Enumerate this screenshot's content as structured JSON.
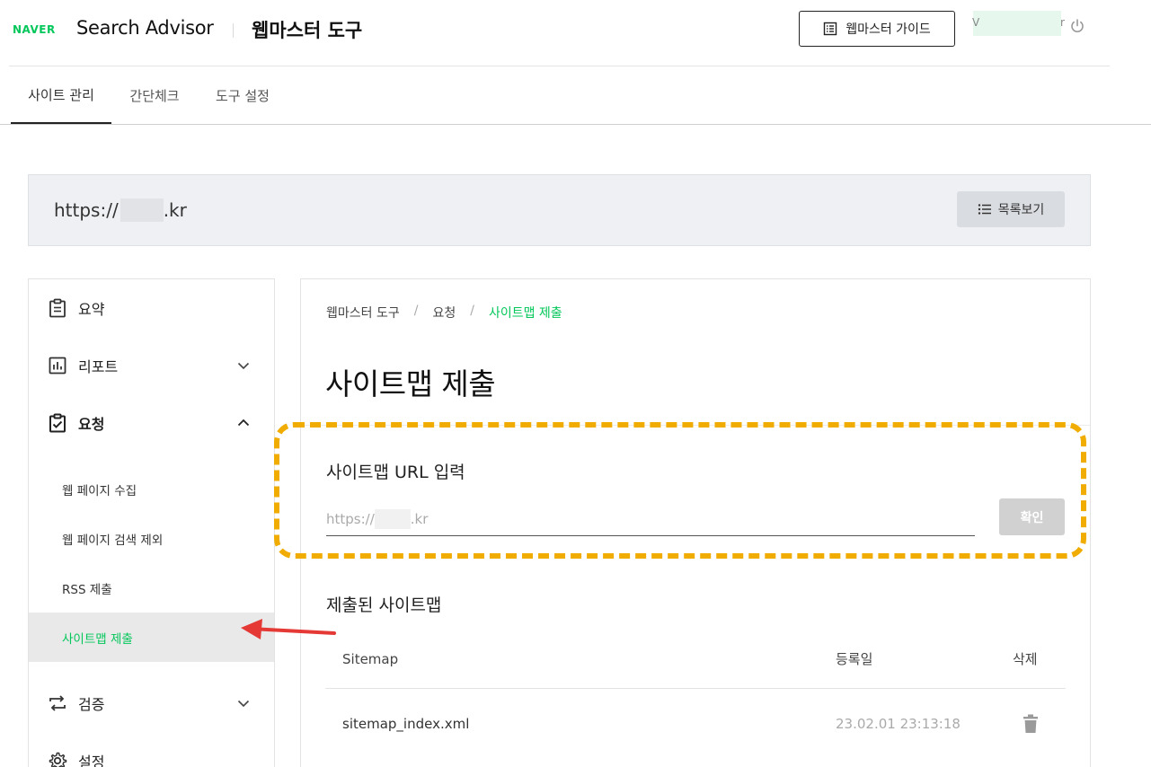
{
  "header": {
    "naver_logo": "NAVER",
    "brand": "Search Advisor",
    "subtitle": "웹마스터 도구",
    "guide_button": "웹마스터 가이드",
    "user_initial": "V",
    "user_tail": "r"
  },
  "nav": {
    "tabs": [
      {
        "label": "사이트 관리",
        "active": true
      },
      {
        "label": "간단체크",
        "active": false
      },
      {
        "label": "도구 설정",
        "active": false
      }
    ]
  },
  "site": {
    "url_prefix": "https://",
    "url_suffix": ".kr",
    "list_button": "목록보기"
  },
  "sidebar": {
    "items": [
      {
        "label": "요약",
        "icon": "clipboard-icon"
      },
      {
        "label": "리포트",
        "icon": "bar-chart-icon",
        "expanded": false
      },
      {
        "label": "요청",
        "icon": "checklist-icon",
        "expanded": true
      },
      {
        "label": "검증",
        "icon": "swap-arrows-icon",
        "expanded": false
      },
      {
        "label": "설정",
        "icon": "gear-icon"
      }
    ],
    "sub_items": [
      {
        "label": "웹 페이지 수집",
        "active": false
      },
      {
        "label": "웹 페이지 검색 제외",
        "active": false
      },
      {
        "label": "RSS 제출",
        "active": false
      },
      {
        "label": "사이트맵 제출",
        "active": true
      }
    ]
  },
  "main": {
    "breadcrumb": [
      "웹마스터 도구",
      "요청",
      "사이트맵 제출"
    ],
    "breadcrumb_sep": "/",
    "title": "사이트맵 제출",
    "input_section_title": "사이트맵 URL 입력",
    "input_prefix": "https://",
    "input_suffix": ".kr",
    "confirm_button": "확인",
    "submitted_title": "제출된 사이트맵",
    "table": {
      "headers": [
        "Sitemap",
        "등록일",
        "삭제"
      ],
      "rows": [
        {
          "sitemap": "sitemap_index.xml",
          "date": "23.02.01 23:13:18"
        }
      ]
    }
  },
  "colors": {
    "accent": "#03c75a",
    "highlight": "#f0ac00",
    "arrow": "#e53935"
  }
}
